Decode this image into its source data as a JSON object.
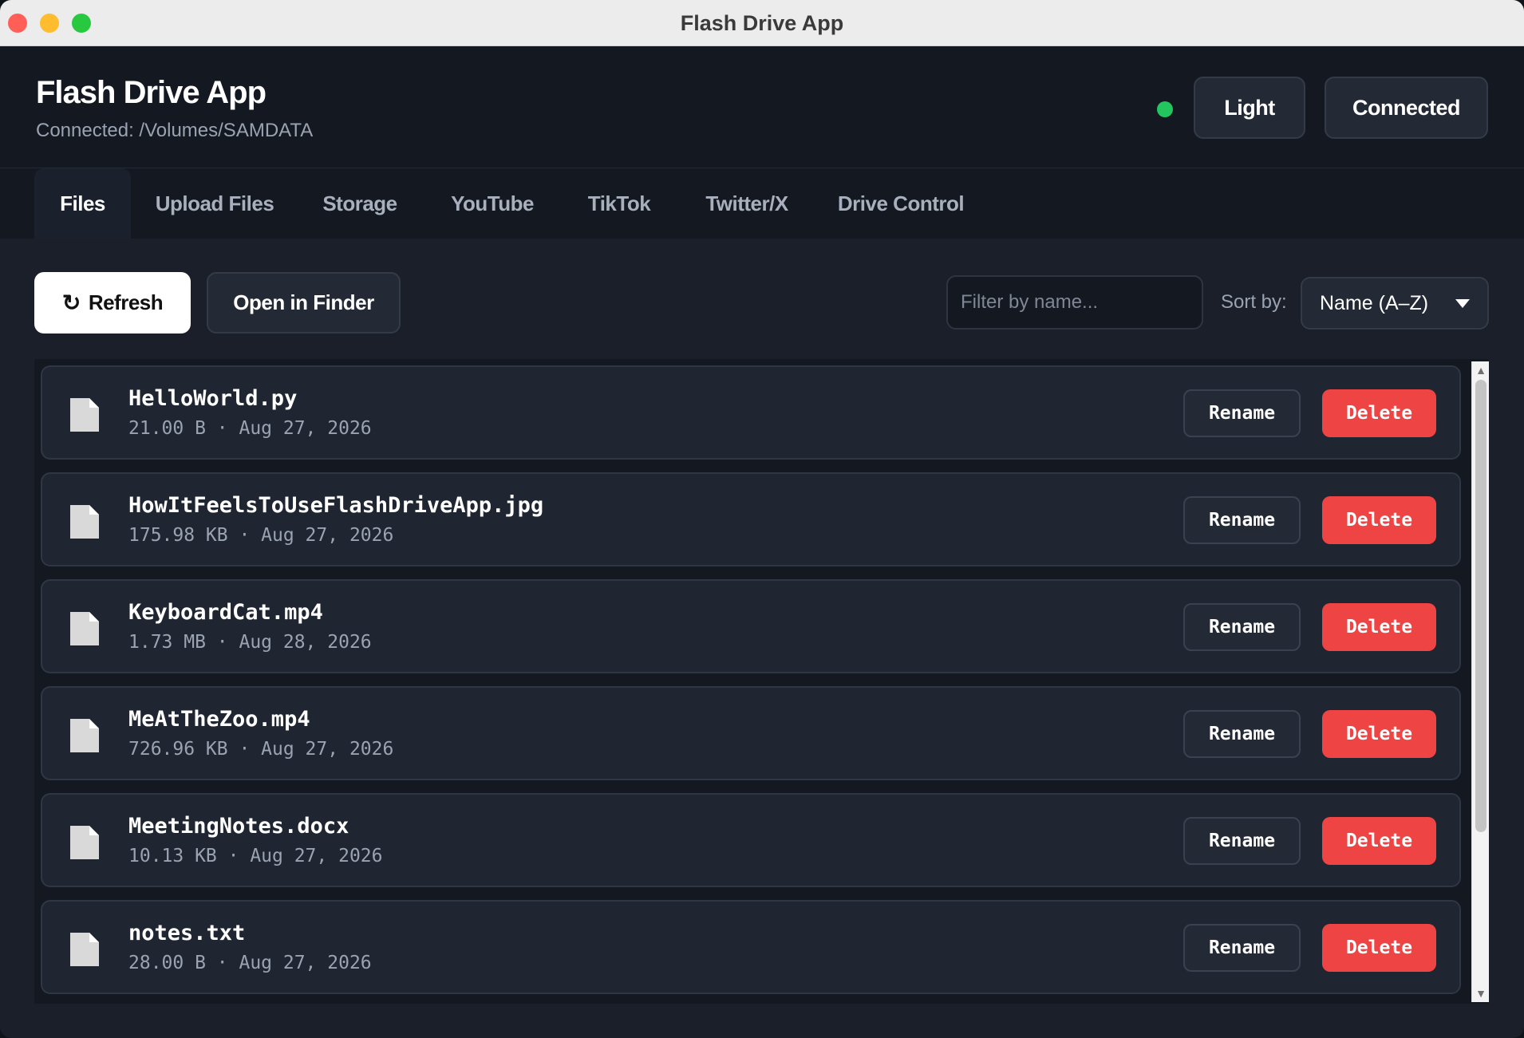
{
  "window": {
    "title": "Flash Drive App"
  },
  "header": {
    "title": "Flash Drive App",
    "subtitle": "Connected: /Volumes/SAMDATA",
    "theme_button": "Light",
    "status_button": "Connected",
    "status_color": "#22c55e"
  },
  "tabs": [
    {
      "label": "Files"
    },
    {
      "label": "Upload Files"
    },
    {
      "label": "Storage"
    },
    {
      "label": "YouTube"
    },
    {
      "label": "TikTok"
    },
    {
      "label": "Twitter/X"
    },
    {
      "label": "Drive Control"
    }
  ],
  "toolbar": {
    "refresh_icon": "↻",
    "refresh_label": "Refresh",
    "finder_label": "Open in Finder",
    "filter_placeholder": "Filter by name...",
    "sort_label": "Sort by:",
    "sort_value": "Name (A–Z)"
  },
  "files": [
    {
      "name": "HelloWorld.py",
      "meta": "21.00 B · Aug 27, 2026",
      "rename": "Rename",
      "delete": "Delete"
    },
    {
      "name": "HowItFeelsToUseFlashDriveApp.jpg",
      "meta": "175.98 KB · Aug 27, 2026",
      "rename": "Rename",
      "delete": "Delete"
    },
    {
      "name": "KeyboardCat.mp4",
      "meta": "1.73 MB · Aug 28, 2026",
      "rename": "Rename",
      "delete": "Delete"
    },
    {
      "name": "MeAtTheZoo.mp4",
      "meta": "726.96 KB · Aug 27, 2026",
      "rename": "Rename",
      "delete": "Delete"
    },
    {
      "name": "MeetingNotes.docx",
      "meta": "10.13 KB · Aug 27, 2026",
      "rename": "Rename",
      "delete": "Delete"
    },
    {
      "name": "notes.txt",
      "meta": "28.00 B · Aug 27, 2026",
      "rename": "Rename",
      "delete": "Delete"
    }
  ],
  "colors": {
    "accent_danger": "#ef4444",
    "background": "#1a1f29"
  }
}
